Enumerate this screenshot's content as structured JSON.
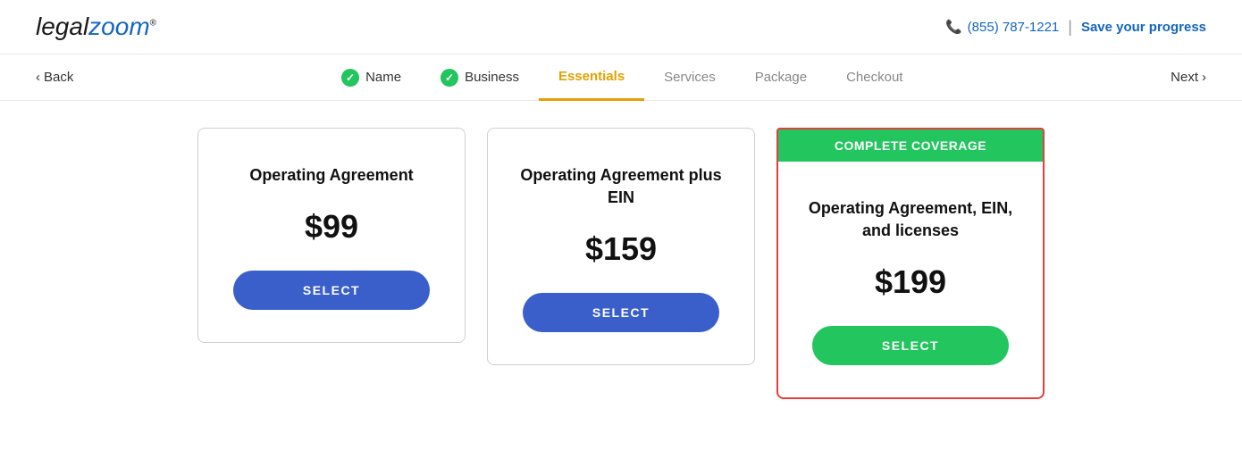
{
  "header": {
    "logo_legal": "legal",
    "logo_zoom": "zoom",
    "logo_trademark": "®",
    "phone_number": "(855) 787-1221",
    "save_progress_label": "Save your progress"
  },
  "nav": {
    "back_label": "Back",
    "next_label": "Next",
    "steps": [
      {
        "id": "name",
        "label": "Name",
        "completed": true,
        "active": false
      },
      {
        "id": "business",
        "label": "Business",
        "completed": true,
        "active": false
      },
      {
        "id": "essentials",
        "label": "Essentials",
        "completed": false,
        "active": true
      },
      {
        "id": "services",
        "label": "Services",
        "completed": false,
        "active": false
      },
      {
        "id": "package",
        "label": "Package",
        "completed": false,
        "active": false
      },
      {
        "id": "checkout",
        "label": "Checkout",
        "completed": false,
        "active": false
      }
    ]
  },
  "cards": [
    {
      "id": "card1",
      "title": "Operating Agreement",
      "price": "$99",
      "select_label": "SELECT",
      "featured": false,
      "banner": null,
      "btn_color": "blue"
    },
    {
      "id": "card2",
      "title": "Operating Agreement plus EIN",
      "price": "$159",
      "select_label": "SELECT",
      "featured": false,
      "banner": null,
      "btn_color": "blue"
    },
    {
      "id": "card3",
      "title": "Operating Agreement, EIN, and licenses",
      "price": "$199",
      "select_label": "SELECT",
      "featured": true,
      "banner": "COMPLETE COVERAGE",
      "btn_color": "green"
    }
  ]
}
